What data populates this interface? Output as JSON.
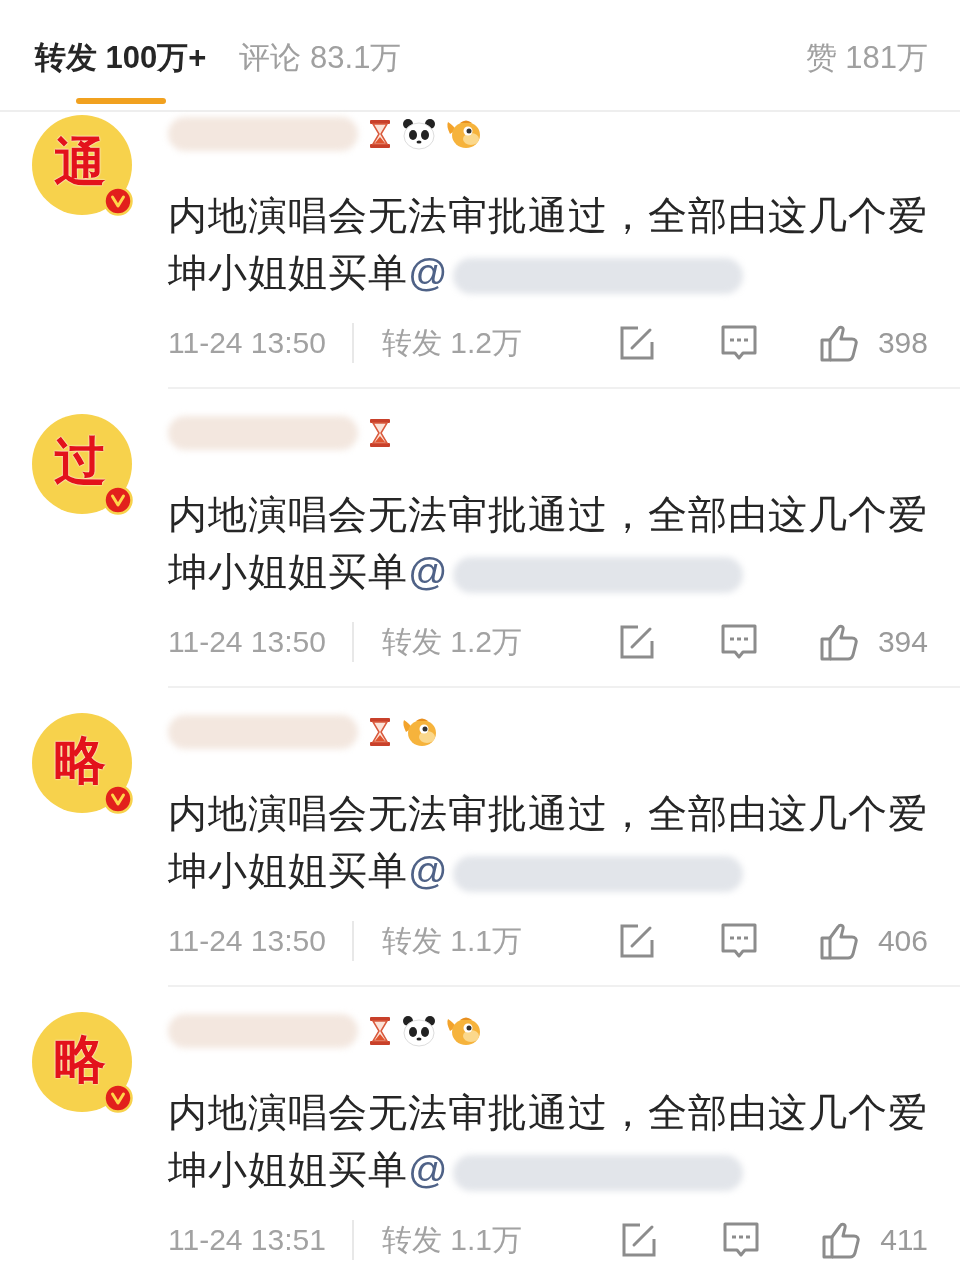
{
  "tabs": [
    {
      "label": "转发 100万+",
      "selected": true
    },
    {
      "label": "评论 83.1万",
      "selected": false
    },
    {
      "label": "赞 181万",
      "selected": false
    }
  ],
  "posts": [
    {
      "avatar_text": "通",
      "verified": true,
      "name_redacted": true,
      "badges": [
        {
          "kind": "hourglass"
        },
        {
          "kind": "panda"
        },
        {
          "kind": "fish"
        }
      ],
      "text": "内地演唱会无法审批通过，全部由这几个爱坤小姐姐买单",
      "mention": "@",
      "mention_redacted": true,
      "time": "11-24 13:50",
      "reposts": "转发 1.2万",
      "likes": "398"
    },
    {
      "avatar_text": "过",
      "verified": true,
      "name_redacted": true,
      "badges": [
        {
          "kind": "hourglass"
        }
      ],
      "text": "内地演唱会无法审批通过，全部由这几个爱坤小姐姐买单",
      "mention": "@",
      "mention_redacted": true,
      "time": "11-24 13:50",
      "reposts": "转发 1.2万",
      "likes": "394"
    },
    {
      "avatar_text": "略",
      "verified": true,
      "name_redacted": true,
      "badges": [
        {
          "kind": "hourglass"
        },
        {
          "kind": "fish"
        }
      ],
      "text": "内地演唱会无法审批通过，全部由这几个爱坤小姐姐买单",
      "mention": "@",
      "mention_redacted": true,
      "time": "11-24 13:50",
      "reposts": "转发 1.1万",
      "likes": "406"
    },
    {
      "avatar_text": "略",
      "verified": true,
      "name_redacted": true,
      "badges": [
        {
          "kind": "hourglass"
        },
        {
          "kind": "panda"
        },
        {
          "kind": "fish"
        }
      ],
      "text": "内地演唱会无法审批通过，全部由这几个爱坤小姐姐买单",
      "mention": "@",
      "mention_redacted": true,
      "time": "11-24 13:51",
      "reposts": "转发 1.1万",
      "likes": "411"
    }
  ]
}
